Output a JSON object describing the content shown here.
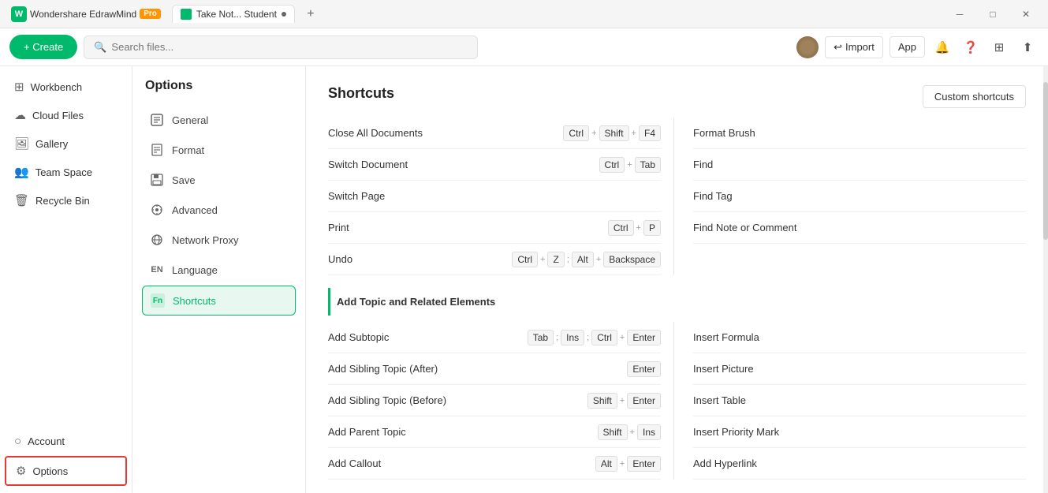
{
  "titleBar": {
    "appName": "Wondershare EdrawMind",
    "proBadge": "Pro",
    "tab1": "Take Not... Student",
    "tabDot": "●",
    "addTab": "+",
    "minimize": "─",
    "maximize": "□",
    "close": "✕"
  },
  "toolbar": {
    "createLabel": "+ Create",
    "searchPlaceholder": "Search files...",
    "importLabel": "Import",
    "appLabel": "App"
  },
  "sidebar": {
    "items": [
      {
        "id": "workbench",
        "label": "Workbench",
        "icon": "⊞"
      },
      {
        "id": "cloud-files",
        "label": "Cloud Files",
        "icon": "☁"
      },
      {
        "id": "gallery",
        "label": "Gallery",
        "icon": "⬜"
      },
      {
        "id": "team-space",
        "label": "Team Space",
        "icon": "👥"
      },
      {
        "id": "recycle-bin",
        "label": "Recycle Bin",
        "icon": "🗑"
      }
    ],
    "bottomItems": [
      {
        "id": "account",
        "label": "Account",
        "icon": "○"
      },
      {
        "id": "options",
        "label": "Options",
        "icon": "⚙"
      }
    ]
  },
  "optionsPanel": {
    "title": "Options",
    "items": [
      {
        "id": "general",
        "label": "General",
        "icon": "⊟"
      },
      {
        "id": "format",
        "label": "Format",
        "icon": "📄"
      },
      {
        "id": "save",
        "label": "Save",
        "icon": "💾"
      },
      {
        "id": "advanced",
        "label": "Advanced",
        "icon": "⚙"
      },
      {
        "id": "network-proxy",
        "label": "Network Proxy",
        "icon": "🌐"
      },
      {
        "id": "language",
        "label": "Language",
        "icon": "EN"
      },
      {
        "id": "shortcuts",
        "label": "Shortcuts",
        "icon": "Fn"
      }
    ]
  },
  "content": {
    "title": "Shortcuts",
    "customShortcutsBtn": "Custom shortcuts",
    "generalShortcuts": [
      {
        "name": "Close All Documents",
        "keys": [
          [
            "Ctrl"
          ],
          [
            "+"
          ],
          [
            "Shift"
          ],
          [
            "+"
          ],
          [
            "F4"
          ]
        ]
      },
      {
        "name": "Switch Document",
        "keys": [
          [
            "Ctrl"
          ],
          [
            "+"
          ],
          [
            "Tab"
          ]
        ]
      },
      {
        "name": "Switch Page",
        "keys": []
      },
      {
        "name": "Print",
        "keys": [
          [
            "Ctrl"
          ],
          [
            "+"
          ],
          [
            "P"
          ]
        ]
      },
      {
        "name": "Undo",
        "keys": [
          [
            "Ctrl"
          ],
          [
            "+"
          ],
          [
            "Z"
          ],
          [
            ";"
          ],
          [
            "Alt"
          ],
          [
            "+"
          ],
          [
            "Backspace"
          ]
        ]
      }
    ],
    "generalShortcutsRight": [
      {
        "name": "Format Brush",
        "keys": []
      },
      {
        "name": "Find",
        "keys": []
      },
      {
        "name": "Find Tag",
        "keys": []
      },
      {
        "name": "Find Note or Comment",
        "keys": []
      }
    ],
    "addTopicSection": "Add Topic and Related Elements",
    "addTopicShortcuts": [
      {
        "name": "Add Subtopic",
        "keys": [
          [
            "Tab"
          ],
          [
            ";"
          ],
          [
            "Ins"
          ],
          [
            ";"
          ],
          [
            "Ctrl"
          ],
          [
            "+"
          ],
          [
            "Enter"
          ]
        ]
      },
      {
        "name": "Add Sibling Topic (After)",
        "keys": [
          [
            "Enter"
          ]
        ]
      },
      {
        "name": "Add Sibling Topic (Before)",
        "keys": [
          [
            "Shift"
          ],
          [
            "+"
          ],
          [
            "Enter"
          ]
        ]
      },
      {
        "name": "Add Parent Topic",
        "keys": [
          [
            "Shift"
          ],
          [
            "+"
          ],
          [
            "Ins"
          ]
        ]
      },
      {
        "name": "Add Callout",
        "keys": [
          [
            "Alt"
          ],
          [
            "+"
          ],
          [
            "Enter"
          ]
        ]
      }
    ],
    "addTopicShortcutsRight": [
      {
        "name": "Insert Formula",
        "keys": []
      },
      {
        "name": "Insert Picture",
        "keys": []
      },
      {
        "name": "Insert Table",
        "keys": []
      },
      {
        "name": "Insert Priority Mark",
        "keys": []
      },
      {
        "name": "Add Hyperlink",
        "keys": []
      }
    ]
  }
}
